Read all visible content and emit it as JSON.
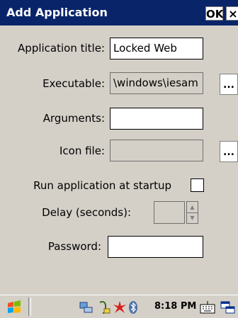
{
  "window": {
    "title": "Add Application",
    "ok_label": "OK",
    "close_label": "×"
  },
  "form": {
    "app_title_label": "Application title:",
    "app_title_value": "Locked Web",
    "executable_label": "Executable:",
    "executable_value": "\\windows\\iesam",
    "browse_label": "...",
    "arguments_label": "Arguments:",
    "arguments_value": "",
    "icon_label": "Icon file:",
    "icon_value": "",
    "run_startup_label": "Run application at startup",
    "run_startup_checked": false,
    "delay_label": "Delay (seconds):",
    "delay_value": "",
    "password_label": "Password:",
    "password_value": ""
  },
  "taskbar": {
    "clock": "8:18 PM",
    "icons": [
      "windows-logo-icon",
      "network-icon",
      "usb-icon",
      "alert-icon",
      "bluetooth-icon",
      "keyboard-icon",
      "windows-switch-icon"
    ]
  }
}
